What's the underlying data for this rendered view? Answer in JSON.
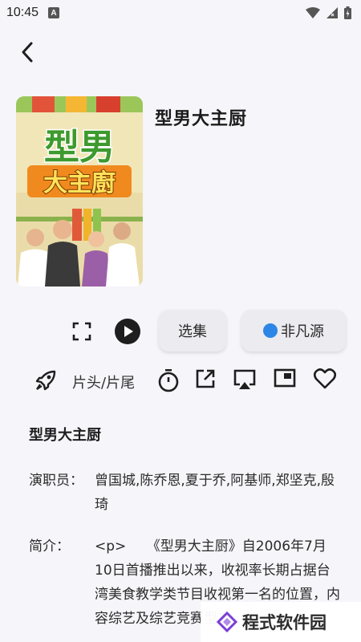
{
  "status_bar": {
    "time": "10:45",
    "app_icon_letter": "A"
  },
  "header": {
    "back_icon": "chevron-left-icon"
  },
  "show": {
    "title": "型男大主厨",
    "poster_title_line1": "型男",
    "poster_title_line2": "大主廚"
  },
  "controls": {
    "episodes_label": "选集",
    "source_label": "非凡源",
    "source_color": "#2d86e6"
  },
  "actions": {
    "intro_outro_label": "片头/片尾",
    "icons": [
      "rocket-icon",
      "timer-icon",
      "open-external-icon",
      "cast-icon",
      "picture-in-picture-icon",
      "heart-icon"
    ]
  },
  "details": {
    "title": "型男大主厨",
    "cast_label": "演职员：",
    "cast_value": "曾国城,陈乔恩,夏于乔,阿基师,郑坚克,殷琦",
    "plot_label": "简介：",
    "plot_value": "<p>　　《型男大主厨》自2006年7月10日首播推出以来，收视率长期占据台湾美食教学类节目收视第一名的位置，内容综艺及综艺竞赛型态，"
  },
  "watermark": {
    "text": "程式软件园"
  }
}
